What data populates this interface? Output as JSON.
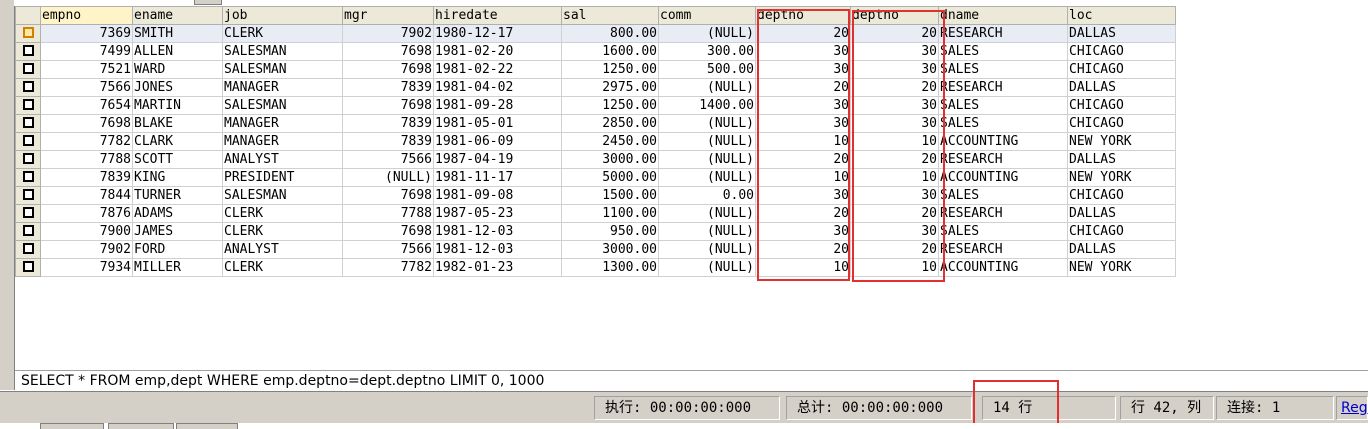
{
  "grid": {
    "columns": [
      "empno",
      "ename",
      "job",
      "mgr",
      "hiredate",
      "sal",
      "comm",
      "deptno",
      "deptno",
      "dname",
      "loc"
    ],
    "rows": [
      [
        "7369",
        "SMITH",
        "CLERK",
        "7902",
        "1980-12-17",
        "800.00",
        "(NULL)",
        "20",
        "20",
        "RESEARCH",
        "DALLAS"
      ],
      [
        "7499",
        "ALLEN",
        "SALESMAN",
        "7698",
        "1981-02-20",
        "1600.00",
        "300.00",
        "30",
        "30",
        "SALES",
        "CHICAGO"
      ],
      [
        "7521",
        "WARD",
        "SALESMAN",
        "7698",
        "1981-02-22",
        "1250.00",
        "500.00",
        "30",
        "30",
        "SALES",
        "CHICAGO"
      ],
      [
        "7566",
        "JONES",
        "MANAGER",
        "7839",
        "1981-04-02",
        "2975.00",
        "(NULL)",
        "20",
        "20",
        "RESEARCH",
        "DALLAS"
      ],
      [
        "7654",
        "MARTIN",
        "SALESMAN",
        "7698",
        "1981-09-28",
        "1250.00",
        "1400.00",
        "30",
        "30",
        "SALES",
        "CHICAGO"
      ],
      [
        "7698",
        "BLAKE",
        "MANAGER",
        "7839",
        "1981-05-01",
        "2850.00",
        "(NULL)",
        "30",
        "30",
        "SALES",
        "CHICAGO"
      ],
      [
        "7782",
        "CLARK",
        "MANAGER",
        "7839",
        "1981-06-09",
        "2450.00",
        "(NULL)",
        "10",
        "10",
        "ACCOUNTING",
        "NEW YORK"
      ],
      [
        "7788",
        "SCOTT",
        "ANALYST",
        "7566",
        "1987-04-19",
        "3000.00",
        "(NULL)",
        "20",
        "20",
        "RESEARCH",
        "DALLAS"
      ],
      [
        "7839",
        "KING",
        "PRESIDENT",
        "(NULL)",
        "1981-11-17",
        "5000.00",
        "(NULL)",
        "10",
        "10",
        "ACCOUNTING",
        "NEW YORK"
      ],
      [
        "7844",
        "TURNER",
        "SALESMAN",
        "7698",
        "1981-09-08",
        "1500.00",
        "0.00",
        "30",
        "30",
        "SALES",
        "CHICAGO"
      ],
      [
        "7876",
        "ADAMS",
        "CLERK",
        "7788",
        "1987-05-23",
        "1100.00",
        "(NULL)",
        "20",
        "20",
        "RESEARCH",
        "DALLAS"
      ],
      [
        "7900",
        "JAMES",
        "CLERK",
        "7698",
        "1981-12-03",
        "950.00",
        "(NULL)",
        "30",
        "30",
        "SALES",
        "CHICAGO"
      ],
      [
        "7902",
        "FORD",
        "ANALYST",
        "7566",
        "1981-12-03",
        "3000.00",
        "(NULL)",
        "20",
        "20",
        "RESEARCH",
        "DALLAS"
      ],
      [
        "7934",
        "MILLER",
        "CLERK",
        "7782",
        "1982-01-23",
        "1300.00",
        "(NULL)",
        "10",
        "10",
        "ACCOUNTING",
        "NEW YORK"
      ]
    ]
  },
  "query": {
    "sql": "SELECT * FROM emp,dept WHERE emp.deptno=dept.deptno  LIMIT 0, 1000"
  },
  "status": {
    "exec": "执行: 00:00:00:000",
    "total": "总计: 00:00:00:000",
    "rows": "14 行",
    "position": "行 42, 列",
    "connection": "连接: 1",
    "reg": "Reg"
  },
  "colors": {
    "highlight_box": "#e03030",
    "header_bg": "#ece9d8",
    "status_bg": "#d4d0c8"
  }
}
